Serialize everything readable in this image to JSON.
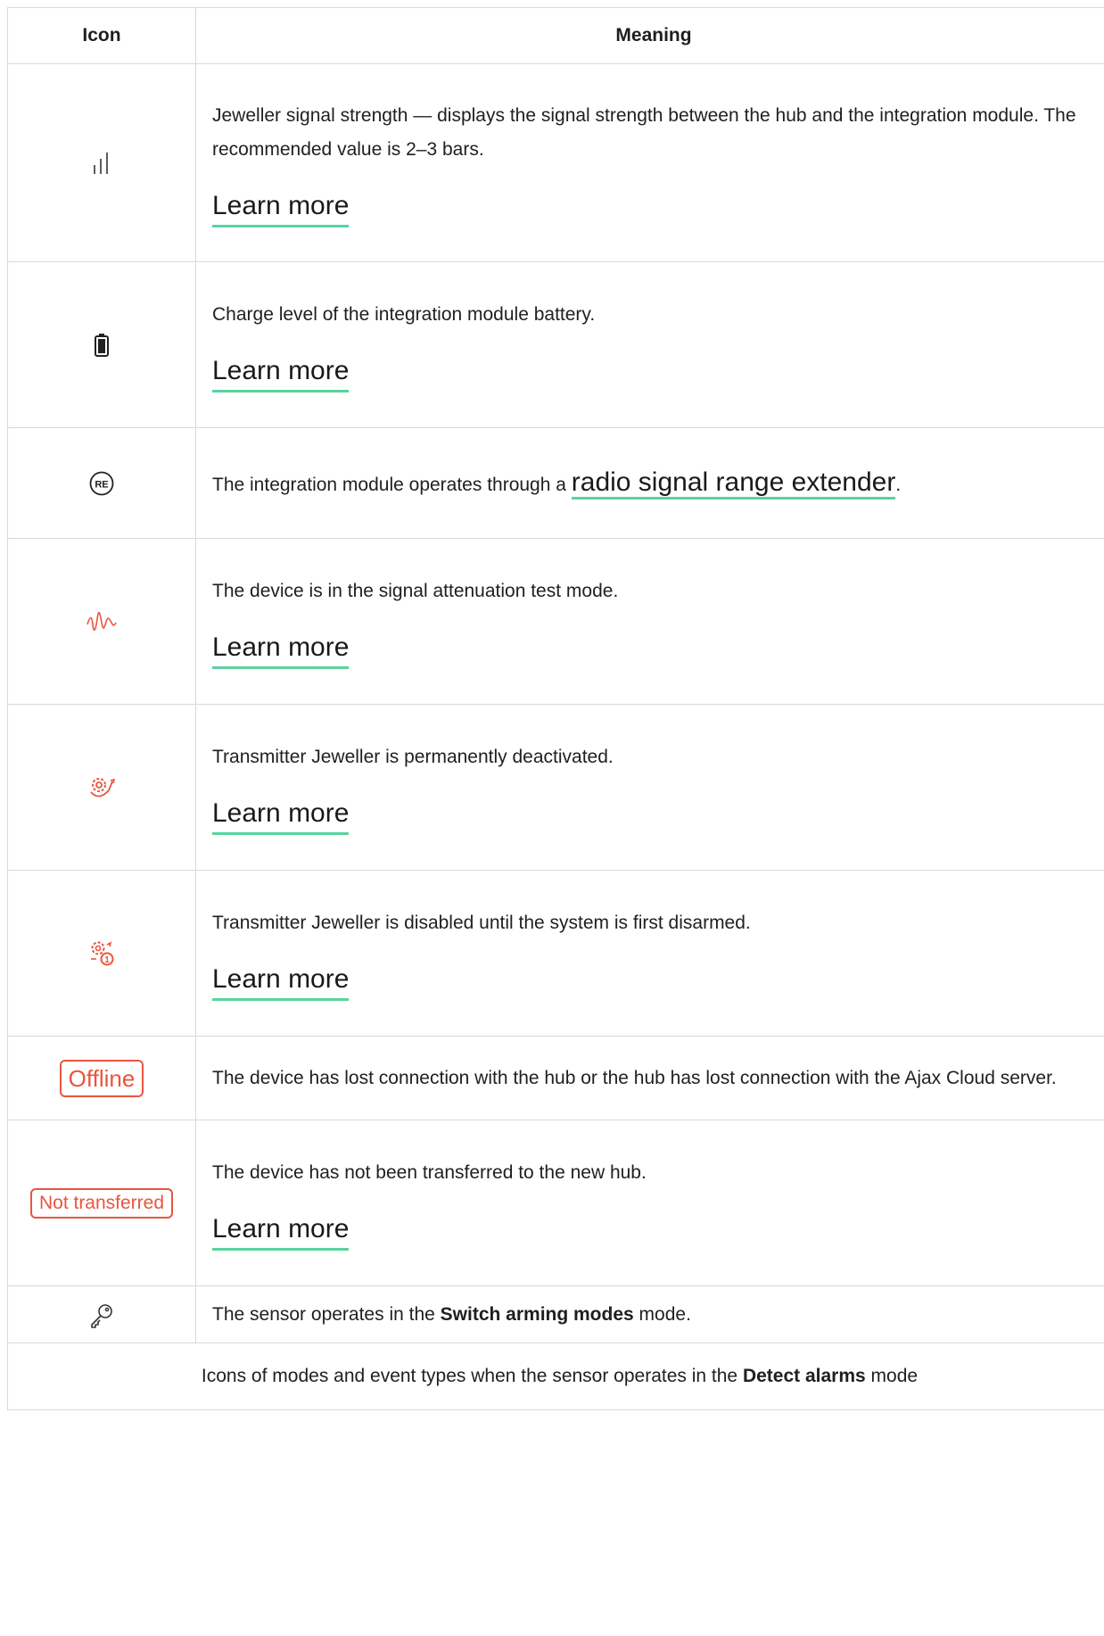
{
  "headers": {
    "icon": "Icon",
    "meaning": "Meaning"
  },
  "rows": [
    {
      "icon": "signal-strength-icon",
      "text": "Jeweller signal strength — displays the signal strength between the hub and the integration module. The recommended value is 2–3 bars.",
      "link": "Learn more"
    },
    {
      "icon": "battery-icon",
      "text": "Charge level of the integration module battery.",
      "link": "Learn more"
    },
    {
      "icon": "range-extender-re-icon",
      "text_before": "The integration module operates through a ",
      "link": "radio signal range extender",
      "text_after": "."
    },
    {
      "icon": "signal-attenuation-wave-icon",
      "text": "The device is in the signal attenuation test mode.",
      "link": "Learn more"
    },
    {
      "icon": "jeweller-deactivated-icon",
      "text": "Transmitter Jeweller is permanently deactivated.",
      "link": "Learn more"
    },
    {
      "icon": "jeweller-disabled-until-disarm-icon",
      "text": "Transmitter Jeweller is disabled until the system is first disarmed.",
      "link": "Learn more"
    },
    {
      "badge": "Offline",
      "text": "The device has lost connection with the hub or the hub has lost connection with the Ajax Cloud server."
    },
    {
      "badge": "Not transferred",
      "text": "The device has not been transferred to the new hub.",
      "link": "Learn more"
    },
    {
      "icon": "key-icon",
      "text_before": "The sensor operates in the ",
      "bold": "Switch arming modes",
      "text_after": " mode."
    }
  ],
  "footer": {
    "text_before": "Icons of modes and event types when the sensor operates in the ",
    "bold": "Detect alarms",
    "text_after": " mode"
  },
  "colors": {
    "accent_underline": "#58d39f",
    "alert": "#e9553e",
    "border": "#d9d9d9"
  }
}
